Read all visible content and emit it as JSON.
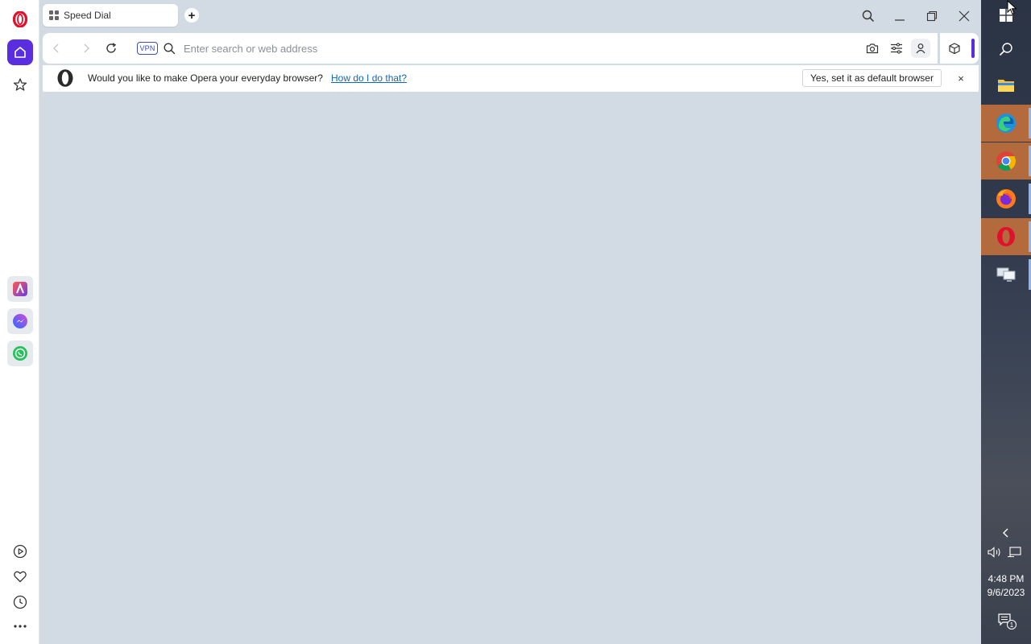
{
  "tab": {
    "title": "Speed Dial"
  },
  "address": {
    "placeholder": "Enter search or web address",
    "vpn_label": "VPN"
  },
  "infobar": {
    "message": "Would you like to make Opera your everyday browser?",
    "link": "How do I do that?",
    "button": "Yes, set it as default browser",
    "close": "×"
  },
  "sidebar": {
    "top": [
      "opera-logo-icon",
      "home-icon",
      "star-icon"
    ],
    "apps": [
      "aria-icon",
      "messenger-icon",
      "whatsapp-icon"
    ],
    "bottom": [
      "player-icon",
      "heart-icon",
      "history-icon",
      "more-icon"
    ]
  },
  "taskbar": {
    "apps": [
      "edge-icon",
      "chrome-icon",
      "firefox-icon",
      "opera-icon",
      "network-icon"
    ],
    "time": "4:48 PM",
    "date": "9/6/2023",
    "notification_count": "1"
  },
  "colors": {
    "accent": "#5b2de0",
    "opera_red": "#e0112b",
    "link": "#1466b8",
    "taskbar_active": "#b36a3c"
  }
}
